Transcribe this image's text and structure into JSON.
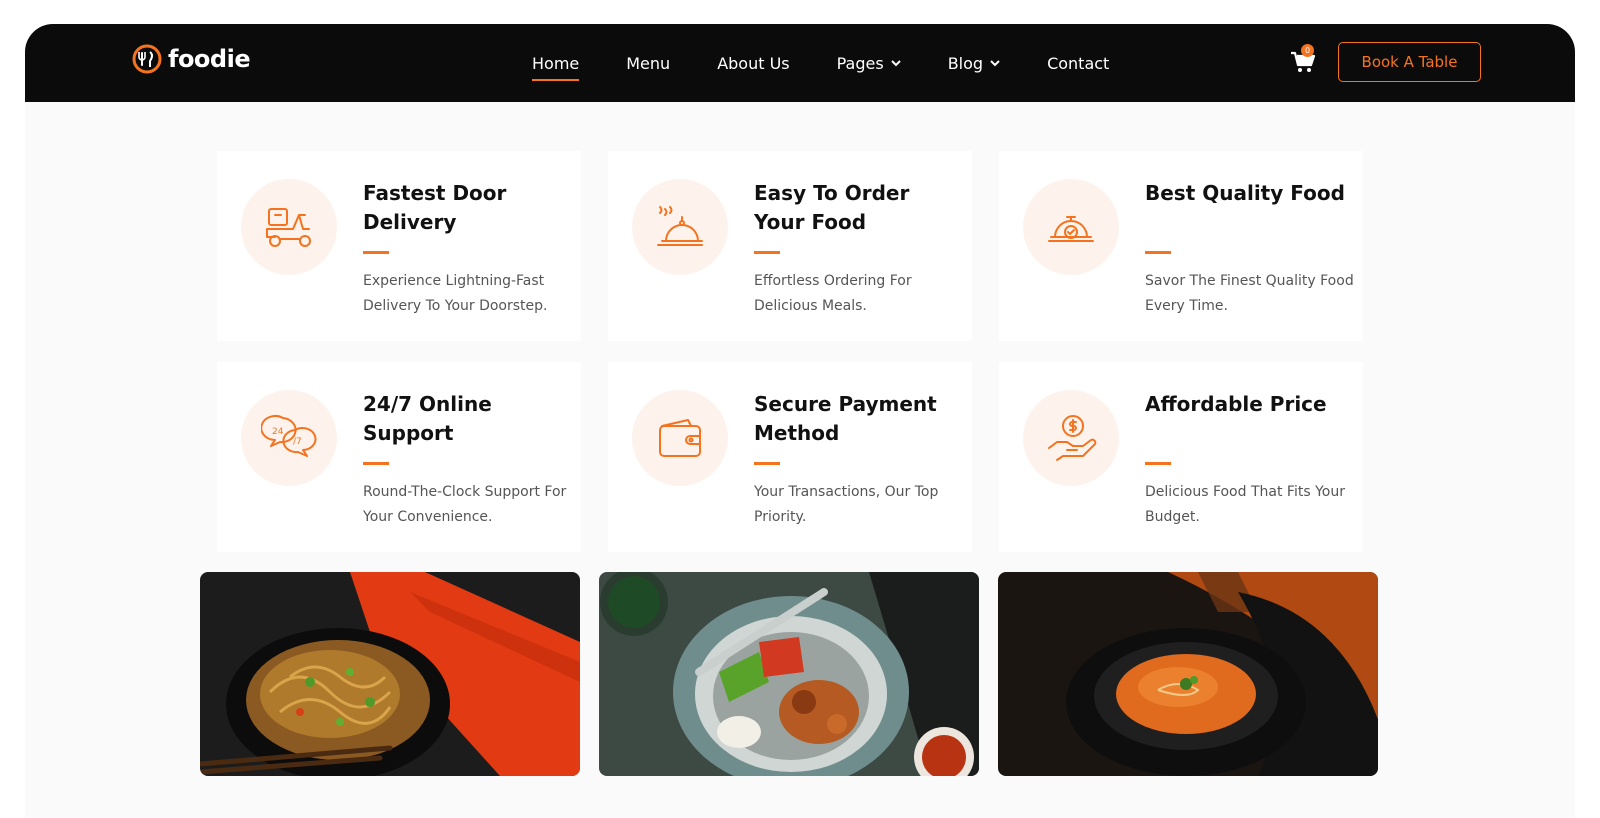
{
  "brand": {
    "name": "foodie",
    "accent": "#f5731f",
    "header_bg": "#0b0b0b"
  },
  "nav": {
    "items": [
      {
        "label": "Home",
        "active": true
      },
      {
        "label": "Menu"
      },
      {
        "label": "About Us"
      },
      {
        "label": "Pages",
        "dropdown": true
      },
      {
        "label": "Blog",
        "dropdown": true
      },
      {
        "label": "Contact"
      }
    ]
  },
  "cart": {
    "icon": "cart-icon",
    "count": "0"
  },
  "header_cta": {
    "label": "Book A Table"
  },
  "features": [
    {
      "icon": "delivery-scooter-icon",
      "title": "Fastest Door Delivery",
      "desc": "Experience Lightning-Fast Delivery To Your Doorstep."
    },
    {
      "icon": "serving-cloche-icon",
      "title": "Easy To Order Your Food",
      "desc": "Effortless Ordering For Delicious Meals."
    },
    {
      "icon": "quality-cloche-icon",
      "title": "Best Quality Food",
      "desc": "Savor The Finest Quality Food Every Time."
    },
    {
      "icon": "support-chat-icon",
      "title": "24/7 Online Support",
      "desc": "Round-The-Clock Support For Your Convenience."
    },
    {
      "icon": "wallet-icon",
      "title": "Secure Payment Method",
      "desc": "Your Transactions, Our Top Priority."
    },
    {
      "icon": "hand-coin-icon",
      "title": "Affordable Price",
      "desc": "Delicious Food That Fits Your Budget."
    }
  ],
  "food_images": [
    {
      "subject": "noodles-bowl"
    },
    {
      "subject": "chicken-vegetable-bowl"
    },
    {
      "subject": "tomato-soup"
    }
  ]
}
